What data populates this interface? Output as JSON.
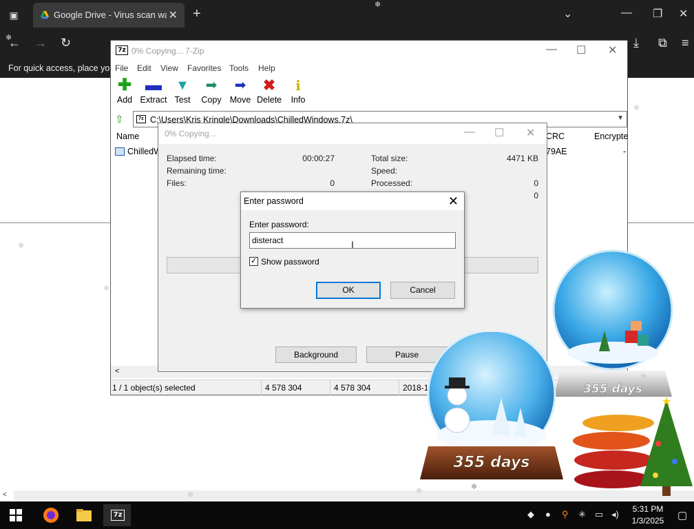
{
  "browser": {
    "tab_title": "Google Drive - Virus scan warni",
    "bookmarks_hint": "For quick access, place your"
  },
  "zip": {
    "title": "0% Copying... 7-Zip",
    "menu": [
      "File",
      "Edit",
      "View",
      "Favorites",
      "Tools",
      "Help"
    ],
    "toolbar": [
      {
        "label": "Add",
        "icon": "add-icon",
        "color": "#1aa31a"
      },
      {
        "label": "Extract",
        "icon": "extract-icon",
        "color": "#1e2fbf"
      },
      {
        "label": "Test",
        "icon": "test-icon",
        "color": "#1aa3a3"
      },
      {
        "label": "Copy",
        "icon": "copy-icon",
        "color": "#1a8a6a"
      },
      {
        "label": "Move",
        "icon": "move-icon",
        "color": "#1e2fbf"
      },
      {
        "label": "Delete",
        "icon": "delete-icon",
        "color": "#d21b1b"
      },
      {
        "label": "Info",
        "icon": "info-icon",
        "color": "#c9b400"
      }
    ],
    "path": "C:\\Users\\Kris Kringle\\Downloads\\ChilledWindows.7z\\",
    "columns": {
      "name": "Name",
      "crc": "CRC",
      "encrypted": "Encrypte"
    },
    "file": {
      "name": "ChilledW",
      "crc": "79AE",
      "encrypted": "-"
    },
    "status": {
      "selected": "1 / 1 object(s) selected",
      "size": "4 578 304",
      "packed": "4 578 304",
      "modified": "2018-1"
    }
  },
  "progress": {
    "title": "0% Copying...",
    "elapsed_label": "Elapsed time:",
    "elapsed_value": "00:00:27",
    "remaining_label": "Remaining time:",
    "files_label": "Files:",
    "files_value": "0",
    "total_label": "Total size:",
    "total_value": "4471 KB",
    "speed_label": "Speed:",
    "processed_label": "Processed:",
    "processed_value": "0",
    "extra_value": "0",
    "percent": 0,
    "background_label": "Background",
    "pause_label": "Pause"
  },
  "password": {
    "title": "Enter password",
    "label": "Enter password:",
    "value": "disteract",
    "show_label": "Show password",
    "show_checked": true,
    "ok": "OK",
    "cancel": "Cancel"
  },
  "wallpaper": {
    "globe1_badge": "355 days",
    "globe2_badge": "355 days"
  },
  "taskbar": {
    "time": "5:31 PM",
    "date": "1/3/2025"
  }
}
